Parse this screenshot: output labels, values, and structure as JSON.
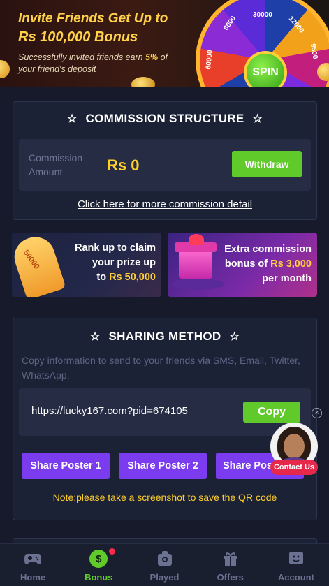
{
  "hero": {
    "title_line1": "Invite Friends Get Up to",
    "title_line2": "Rs 100,000 Bonus",
    "subtitle_prefix": "Successfully invited friends earn ",
    "subtitle_percent": "5%",
    "subtitle_suffix": "of your friend's deposit",
    "wheel_values": [
      "8000",
      "30000",
      "12000",
      "9500",
      "60000"
    ],
    "spin_label": "SPIN"
  },
  "commission": {
    "title": "COMMISSION STRUCTURE",
    "amount_label": "Commission Amount",
    "amount_value": "Rs 0",
    "withdraw_label": "Withdraw",
    "detail_link": "Click here for more commission detail"
  },
  "promos": {
    "left": {
      "line1": "Rank up to claim",
      "line2": "your prize up",
      "line3_prefix": "to ",
      "line3_amount": "Rs 50,000",
      "ticket_value": "50000"
    },
    "right": {
      "line1": "Extra commission",
      "line2_prefix": "bonus of ",
      "line2_amount": "Rs 3,000",
      "line3": "per month"
    }
  },
  "sharing": {
    "title": "SHARING METHOD",
    "description": "Copy information to send to your friends via SMS, Email, Twitter, WhatsApp.",
    "link": "https://lucky167.com?pid=674105",
    "copy_label": "Copy",
    "poster_buttons": [
      "Share Poster 1",
      "Share Poster 2",
      "Share Poster 3"
    ],
    "note": "Note:please take a screenshot to save the QR code"
  },
  "contact": {
    "label": "Contact Us",
    "close": "×"
  },
  "nav": {
    "items": [
      {
        "label": "Home",
        "icon": "gamepad-icon"
      },
      {
        "label": "Bonus",
        "icon": "dollar-coin-icon",
        "active": true
      },
      {
        "label": "Played",
        "icon": "played-icon"
      },
      {
        "label": "Offers",
        "icon": "gift-icon"
      },
      {
        "label": "Account",
        "icon": "account-icon"
      }
    ],
    "bonus_symbol": "$"
  },
  "colors": {
    "accent_green": "#5fca2a",
    "gold": "#ffd02a",
    "purple": "#7b3cf0",
    "contact_red": "#e6284a"
  }
}
